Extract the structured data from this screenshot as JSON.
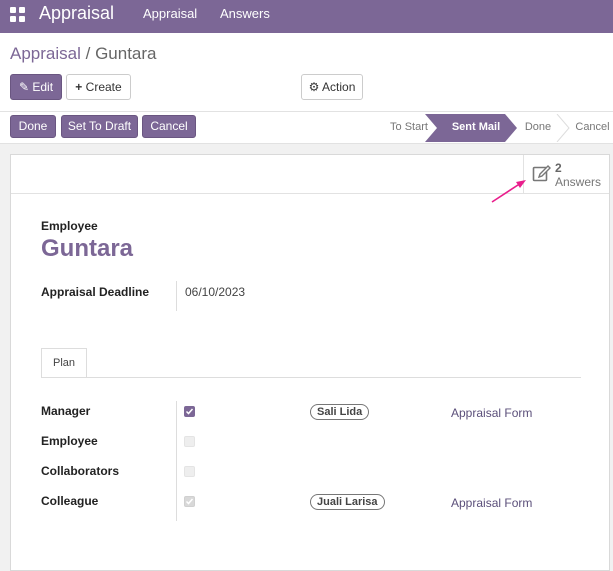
{
  "topbar": {
    "brand": "Appraisal",
    "menu": [
      "Appraisal",
      "Answers"
    ],
    "bg_color": "#7c6796"
  },
  "breadcrumb": {
    "parent": "Appraisal",
    "separator": "/",
    "current": "Guntara"
  },
  "toolbar": {
    "edit_label": "Edit",
    "create_label": "Create",
    "action_label": "Action"
  },
  "header_buttons": {
    "done": "Done",
    "set_to_draft": "Set To Draft",
    "cancel": "Cancel"
  },
  "statusbar": {
    "stages": [
      "To Start",
      "Sent Mail",
      "Done",
      "Cancel"
    ],
    "active": "Sent Mail"
  },
  "smart_button": {
    "count": "2",
    "label": "Answers",
    "icon": "edit-note-icon"
  },
  "form": {
    "employee_label": "Employee",
    "employee_name": "Guntara",
    "deadline_label": "Appraisal Deadline",
    "deadline_value": "06/10/2023"
  },
  "tabs": [
    "Plan"
  ],
  "plan_rows": [
    {
      "label": "Manager",
      "checked": true,
      "tag": "Sali Lida",
      "form": "Appraisal Form"
    },
    {
      "label": "Employee",
      "checked": false,
      "tag": "",
      "form": ""
    },
    {
      "label": "Collaborators",
      "checked": false,
      "tag": "",
      "form": ""
    },
    {
      "label": "Colleague",
      "checked": true,
      "tag": "Juali Larisa",
      "form": "Appraisal Form"
    }
  ],
  "annotation_color": "#e91e8c"
}
